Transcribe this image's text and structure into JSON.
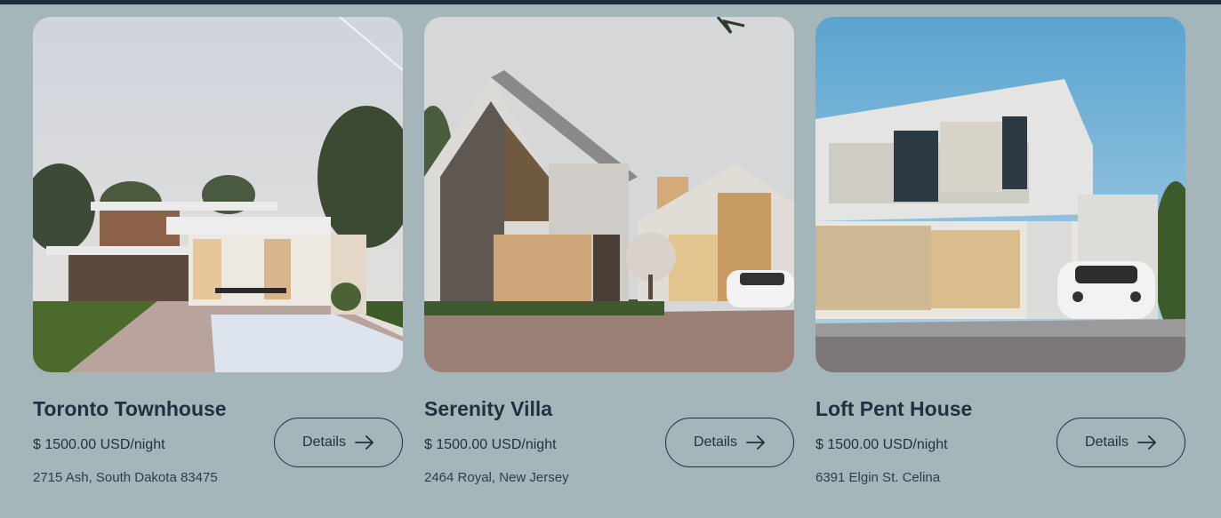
{
  "listings": [
    {
      "title": "Toronto Townhouse",
      "price": "$ 1500.00 USD/night",
      "address": "2715 Ash, South Dakota 83475",
      "button_label": "Details",
      "image_icon": "house-photo"
    },
    {
      "title": "Serenity Villa",
      "price": "$ 1500.00 USD/night",
      "address": "2464 Royal, New Jersey",
      "button_label": "Details",
      "image_icon": "house-photo"
    },
    {
      "title": "Loft Pent House",
      "price": "$ 1500.00 USD/night",
      "address": "6391 Elgin St. Celina",
      "button_label": "Details",
      "image_icon": "house-photo"
    }
  ],
  "colors": {
    "background": "#a5b6bb",
    "text": "#1f3140",
    "topbar": "#1f2e38"
  }
}
